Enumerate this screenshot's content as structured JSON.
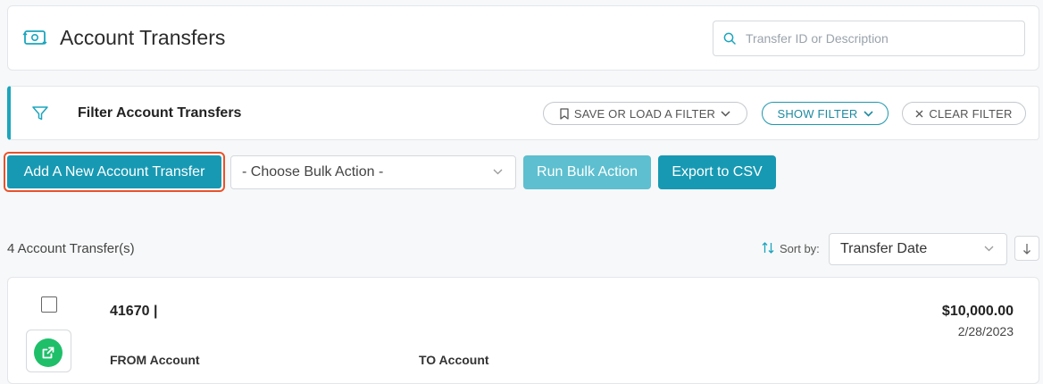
{
  "header": {
    "title": "Account Transfers",
    "search_placeholder": "Transfer ID or Description"
  },
  "filter": {
    "title": "Filter Account Transfers",
    "save_load_label": "SAVE OR LOAD A FILTER",
    "show_filter_label": "SHOW FILTER",
    "clear_filter_label": "CLEAR FILTER"
  },
  "toolbar": {
    "add_label": "Add A New Account Transfer",
    "bulk_action_selected": "- Choose Bulk Action -",
    "run_bulk_label": "Run Bulk Action",
    "export_label": "Export to CSV"
  },
  "list": {
    "count_text": "4 Account Transfer(s)",
    "sort_label": "Sort by:",
    "sort_selected": "Transfer Date"
  },
  "records": [
    {
      "id_text": "41670 |",
      "amount": "$10,000.00",
      "date": "2/28/2023",
      "from_label": "FROM Account",
      "to_label": "TO Account"
    }
  ],
  "colors": {
    "accent": "#1799b3",
    "accent_disabled": "#5dbfcf",
    "highlight_border": "#e8522a",
    "open_icon_bg": "#1fbf6a"
  }
}
